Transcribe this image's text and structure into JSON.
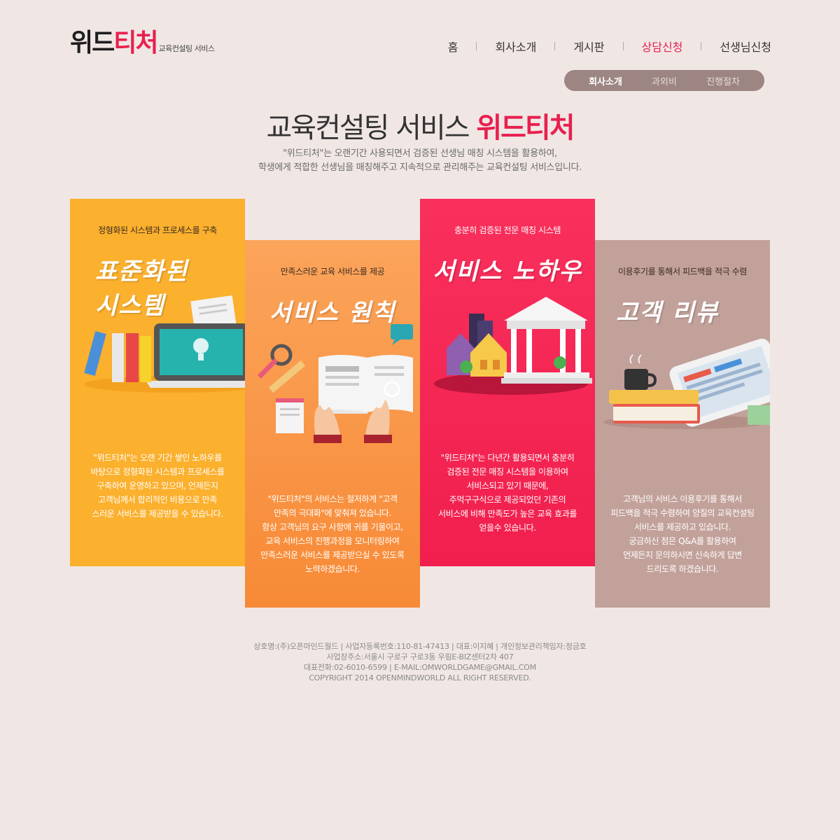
{
  "logo": {
    "main_dark": "위드",
    "main_accent": "티처",
    "sub": "교육컨설팅 서비스"
  },
  "nav": {
    "items": [
      {
        "label": "홈"
      },
      {
        "label": "회사소개"
      },
      {
        "label": "게시판"
      },
      {
        "label": "상담신청",
        "active": true
      },
      {
        "label": "선생님신청"
      }
    ]
  },
  "subnav": {
    "items": [
      {
        "label": "회사소개",
        "active": true
      },
      {
        "label": "과외비"
      },
      {
        "label": "진행절차"
      }
    ]
  },
  "hero": {
    "title_main": "교육컨설팅 서비스 ",
    "title_accent": "위드티처",
    "desc_line1": "\"위드티처\"는 오랜기간 사용되면서 검증된 선생님 매칭 시스템을 활용하여,",
    "desc_line2": "학생에게 적합한 선생님을 매칭해주고 지속적으로 관리해주는 교육컨설팅 서비스입니다."
  },
  "cards": [
    {
      "tagline": "정형화된 시스템과 프로세스를 구축",
      "big_line1": "표준화된",
      "big_line2": "시스템",
      "desc": "\"위드티처\"는 오랜 기간 쌓인 노하우를\n바탕으로 정형화된 시스템과 프로세스를\n구축하여 운영하고 있으며, 언제든지\n고객님께서 합리적인 비용으로 만족\n스러운 서비스를 제공받을 수 있습니다.",
      "icon": "laptop-books-icon"
    },
    {
      "tagline": "만족스러운 교육 서비스를 제공",
      "big_line1": "서비스 원칙",
      "desc": "\"위드티처\"의 서비스는 철저하게  \"고객\n만족의 극대화\"에 맞춰져 있습니다.\n항상 고객님의 요구 사항에 귀를 기울이고,\n교육 서비스의 진행과정을 모니터링하여\n만족스러운 서비스를 제공받으실 수 있도록\n노력하겠습니다.",
      "icon": "open-book-hands-icon"
    },
    {
      "tagline": "충분히 검증된 전문 매칭 시스템",
      "big_line1": "서비스 노하우",
      "desc": "\"위드티처\"는 다년간 활용되면서 충분히\n검증된 전문 매칭 시스템을 이용하여\n서비스되고 있기 때문에,\n주먹구구식으로 제공되었던 기존의\n서비스에 비해 만족도가 높은 교육 효과를\n얻을수 있습니다.",
      "icon": "town-building-icon"
    },
    {
      "tagline": "이용후기를 통해서 피드백을 적극 수렴",
      "big_line1": "고객 리뷰",
      "desc": "고객님의 서비스 이용후기를 통해서\n피드백을 적극 수렴하여 양질의 교육컨설팅\n서비스를 제공하고 있습니다.\n궁금하신 점은 Q&A를 활용하여\n언제든지 문의하시면 신속하게 답변\n드리도록 하겠습니다.",
      "icon": "tablet-coffee-icon"
    }
  ],
  "footer": {
    "line1": "상호명:(주)오픈마인드월드 | 사업자등록번호:110-81-47413 | 대표:이지혜 | 개인정보관리책임자:정금호",
    "line2": "사업장주소:서울시 구로구 구로3동 우림E-BIZ센터2차 407",
    "line3": "대표전화:02-6010-6599 | E-MAIL:OMWORLDGAME@GMAIL.COM",
    "line4": "COPYRIGHT 2014 OPENMINDWORLD ALL RIGHT RESERVED."
  }
}
